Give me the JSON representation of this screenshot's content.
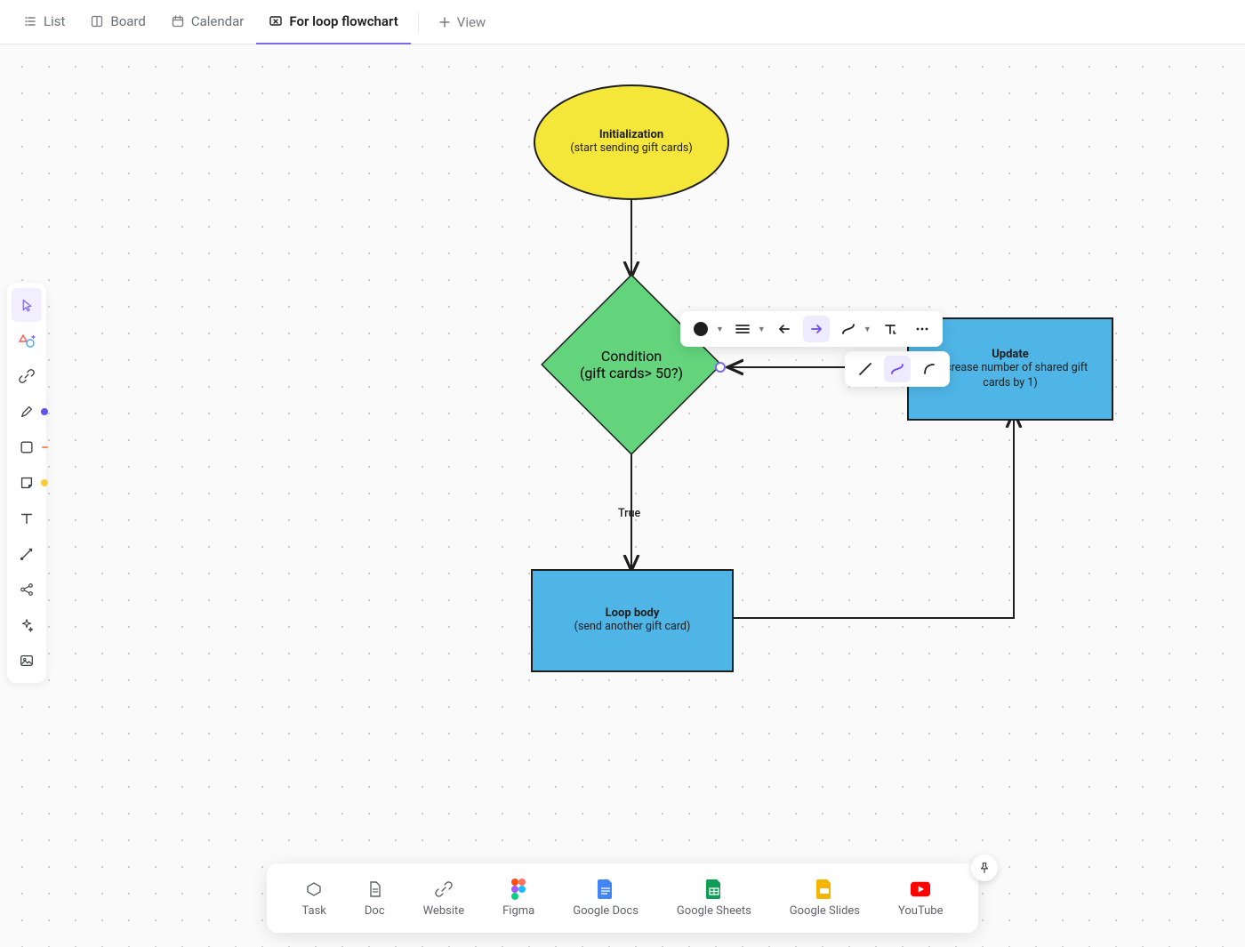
{
  "tabs": {
    "list": "List",
    "board": "Board",
    "calendar": "Calendar",
    "flowchart": "For loop flowchart",
    "add_view": "View"
  },
  "flowchart": {
    "initialization": {
      "title": "Initialization",
      "sub": "(start sending gift cards)"
    },
    "condition": {
      "title": "Condition",
      "sub": "(gift cards> 50?)"
    },
    "update": {
      "title": "Update",
      "sub": "(increase number of shared gift cards by 1)"
    },
    "loop_body": {
      "title": "Loop body",
      "sub": "(send another gift card)"
    },
    "edge_true_label": "True"
  },
  "bottom_cards": {
    "task": "Task",
    "doc": "Doc",
    "website": "Website",
    "figma": "Figma",
    "gdocs": "Google Docs",
    "gsheets": "Google Sheets",
    "gslides": "Google Slides",
    "youtube": "YouTube"
  },
  "left_tools": {
    "select": "select",
    "shape_add": "shape-add",
    "link": "link",
    "pen": "pen",
    "square": "square",
    "sticky": "sticky",
    "text": "text",
    "connector": "connector",
    "mindmap": "mindmap",
    "ai": "ai",
    "image": "image"
  },
  "edge_toolbar": {
    "color": "color",
    "line_style": "line-style",
    "arrow_start": "arrow-start",
    "arrow_end": "arrow-end",
    "curve": "curve",
    "text_style": "text-style",
    "more": "more",
    "straight": "straight",
    "elbow_curve": "elbow-curve",
    "rounded": "rounded"
  }
}
